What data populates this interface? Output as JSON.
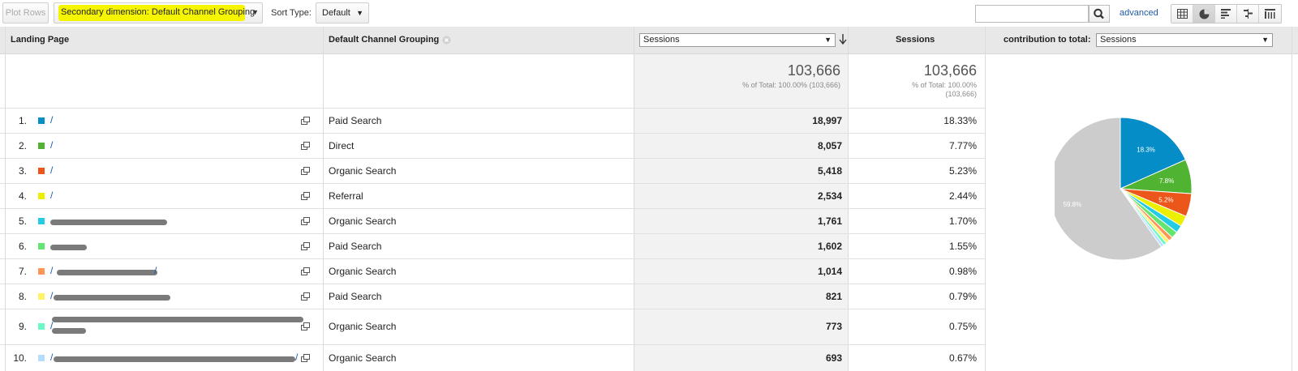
{
  "toolbar": {
    "plot_rows": "Plot Rows",
    "secondary_dimension": "Secondary dimension: Default Channel Grouping",
    "sort_type_label": "Sort Type:",
    "sort_type_value": "Default",
    "search_value": "",
    "advanced": "advanced"
  },
  "columns": {
    "landing_page": "Landing Page",
    "channel": "Default Channel Grouping",
    "metric_select": "Sessions",
    "sessions": "Sessions",
    "contribution_label": "contribution to total:",
    "contribution_select": "Sessions"
  },
  "totals": {
    "sessions_1": "103,666",
    "pct_1": "% of Total: 100.00% (103,666)",
    "sessions_2": "103,666",
    "pct_2a": "% of Total: 100.00%",
    "pct_2b": "(103,666)"
  },
  "rows": [
    {
      "index": "1.",
      "color": "#058dc7",
      "page": "/",
      "channel": "Paid Search",
      "sessions": "18,997",
      "percent": "18.33%"
    },
    {
      "index": "2.",
      "color": "#50b432",
      "page": "/",
      "channel": "Direct",
      "sessions": "8,057",
      "percent": "7.77%"
    },
    {
      "index": "3.",
      "color": "#ed561b",
      "page": "/",
      "channel": "Organic Search",
      "sessions": "5,418",
      "percent": "5.23%"
    },
    {
      "index": "4.",
      "color": "#edef00",
      "page": "/",
      "channel": "Referral",
      "sessions": "2,534",
      "percent": "2.44%"
    },
    {
      "index": "5.",
      "color": "#24cbe5",
      "page": "",
      "channel": "Organic Search",
      "sessions": "1,761",
      "percent": "1.70%"
    },
    {
      "index": "6.",
      "color": "#64e572",
      "page": "",
      "channel": "Paid Search",
      "sessions": "1,602",
      "percent": "1.55%"
    },
    {
      "index": "7.",
      "color": "#ff9655",
      "page": "/",
      "channel": "Organic Search",
      "sessions": "1,014",
      "percent": "0.98%"
    },
    {
      "index": "8.",
      "color": "#fff263",
      "page": "/",
      "channel": "Paid Search",
      "sessions": "821",
      "percent": "0.79%"
    },
    {
      "index": "9.",
      "color": "#6af9c4",
      "page": "/",
      "channel": "Organic Search",
      "sessions": "773",
      "percent": "0.75%"
    },
    {
      "index": "10.",
      "color": "#b2deff",
      "page": "/",
      "channel": "Organic Search",
      "sessions": "693",
      "percent": "0.67%"
    }
  ],
  "pie": {
    "labels": [
      "18.3%",
      "7.8%",
      "5.2%",
      "59.8%"
    ],
    "slices": [
      {
        "value": 18.33,
        "color": "#058dc7"
      },
      {
        "value": 7.77,
        "color": "#50b432"
      },
      {
        "value": 5.23,
        "color": "#ed561b"
      },
      {
        "value": 2.44,
        "color": "#edef00"
      },
      {
        "value": 1.7,
        "color": "#24cbe5"
      },
      {
        "value": 1.55,
        "color": "#64e572"
      },
      {
        "value": 0.98,
        "color": "#ff9655"
      },
      {
        "value": 0.79,
        "color": "#fff263"
      },
      {
        "value": 0.75,
        "color": "#6af9c4"
      },
      {
        "value": 0.67,
        "color": "#b2deff"
      },
      {
        "value": 59.79,
        "color": "#cccccc"
      }
    ]
  }
}
